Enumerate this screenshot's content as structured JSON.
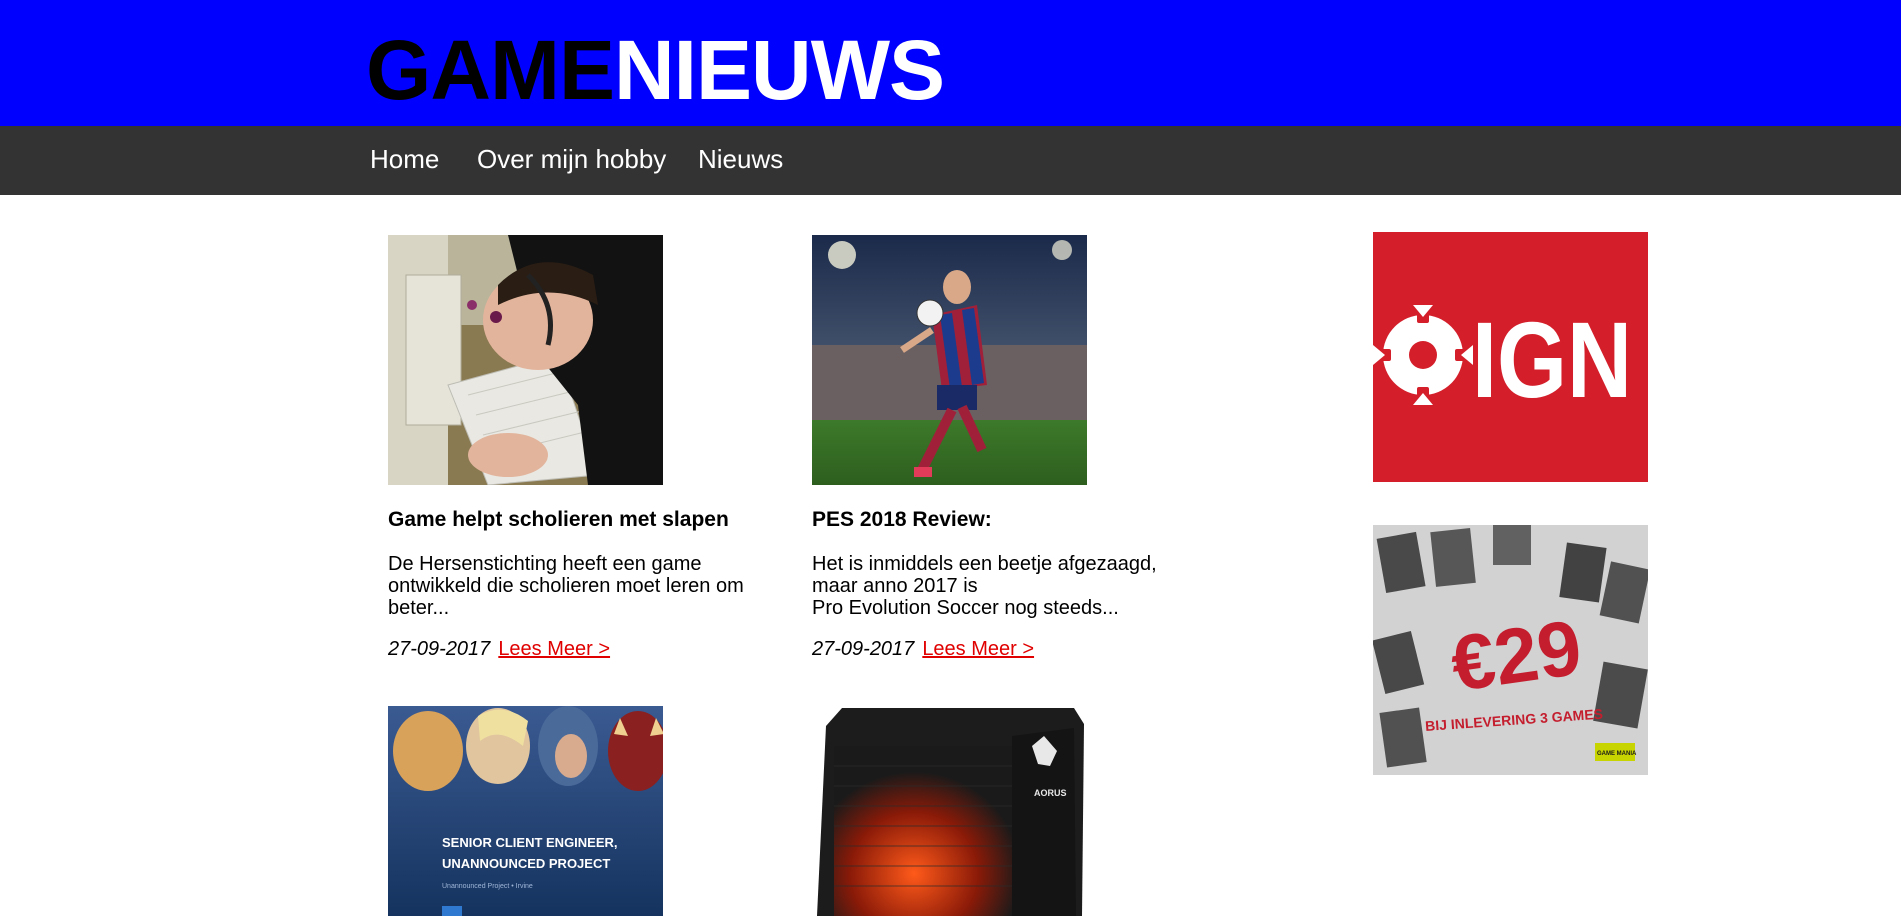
{
  "header": {
    "logo_dark": "GAME",
    "logo_light": "NIEUWS",
    "bg_color": "#0000ff"
  },
  "nav": {
    "items": [
      {
        "label": "Home"
      },
      {
        "label": "Over mijn hobby"
      },
      {
        "label": "Nieuws"
      }
    ]
  },
  "articles": [
    {
      "title": "Game helpt scholieren met slapen",
      "excerpt_lines": [
        "De Hersenstichting heeft een game",
        "ontwikkeld die scholieren moet leren om",
        "beter..."
      ],
      "date": "27-09-2017",
      "link": "Lees Meer >",
      "image": "person-asleep-on-keyboard"
    },
    {
      "title": "PES 2018 Review:",
      "excerpt_lines": [
        "Het is inmiddels een beetje afgezaagd,",
        "maar anno 2017 is",
        "Pro Evolution Soccer nog steeds..."
      ],
      "date": "27-09-2017",
      "link": "Lees Meer >",
      "image": "football-player-kicking-ball"
    },
    {
      "image": "blizzard-heroes-job-banner",
      "image_text": [
        "SENIOR CLIENT ENGINEER,",
        "UNANNOUNCED PROJECT",
        "Unannounced Project • Irvine"
      ]
    },
    {
      "image": "aorus-gaming-box",
      "image_text": [
        "AORUS"
      ]
    }
  ],
  "ads": [
    {
      "name": "ign-ad",
      "text": "IGN",
      "bg": "#d41f2b"
    },
    {
      "name": "gamemania-ad",
      "price": "€29",
      "subtext": "BIJ INLEVERING 3 GAMES",
      "badge": "GAME MANIA"
    }
  ]
}
